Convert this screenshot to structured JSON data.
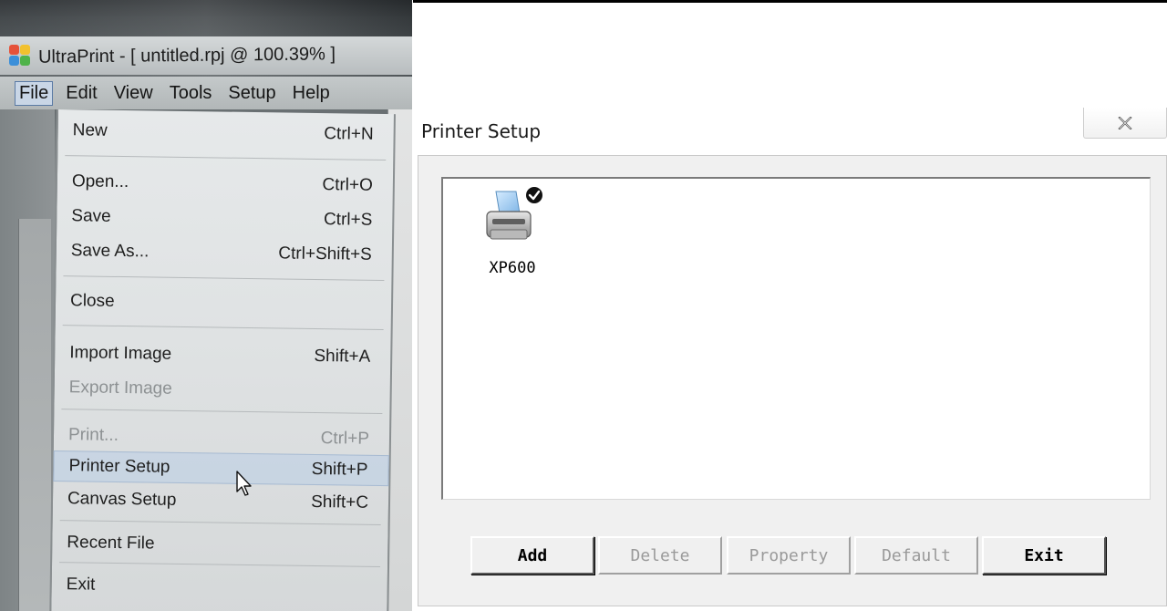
{
  "app": {
    "title": "UltraPrint - [ untitled.rpj @ 100.39% ]"
  },
  "menubar": {
    "items": [
      "File",
      "Edit",
      "View",
      "Tools",
      "Setup",
      "Help"
    ]
  },
  "file_menu": {
    "items": [
      {
        "label": "New",
        "shortcut": "Ctrl+N",
        "enabled": true
      },
      {
        "label": "Open...",
        "shortcut": "Ctrl+O",
        "enabled": true
      },
      {
        "label": "Save",
        "shortcut": "Ctrl+S",
        "enabled": true
      },
      {
        "label": "Save As...",
        "shortcut": "Ctrl+Shift+S",
        "enabled": true
      },
      {
        "label": "Close",
        "shortcut": "",
        "enabled": true
      },
      {
        "label": "Import Image",
        "shortcut": "Shift+A",
        "enabled": true
      },
      {
        "label": "Export Image",
        "shortcut": "",
        "enabled": false
      },
      {
        "label": "Print...",
        "shortcut": "Ctrl+P",
        "enabled": false
      },
      {
        "label": "Printer Setup",
        "shortcut": "Shift+P",
        "enabled": true,
        "highlighted": true
      },
      {
        "label": "Canvas Setup",
        "shortcut": "Shift+C",
        "enabled": true
      },
      {
        "label": "Recent File",
        "shortcut": "",
        "enabled": true
      },
      {
        "label": "Exit",
        "shortcut": "",
        "enabled": true
      }
    ]
  },
  "dialog": {
    "title": "Printer Setup",
    "close_glyph": "✕",
    "printers": [
      {
        "name": "XP600",
        "is_default": true
      }
    ],
    "buttons": [
      {
        "label": "Add",
        "enabled": true
      },
      {
        "label": "Delete",
        "enabled": false
      },
      {
        "label": "Property",
        "enabled": false
      },
      {
        "label": "Default",
        "enabled": false
      },
      {
        "label": "Exit",
        "enabled": true
      }
    ]
  },
  "icons": {
    "app": "ultraprint-logo-icon",
    "printer": "printer-icon",
    "default_check": "check-badge-icon",
    "close": "close-icon",
    "cursor": "mouse-pointer-icon"
  },
  "colors": {
    "menu_highlight": "#c9d6e6",
    "dialog_bg": "#f0f0f0",
    "disabled_text": "#9a9a9a"
  }
}
